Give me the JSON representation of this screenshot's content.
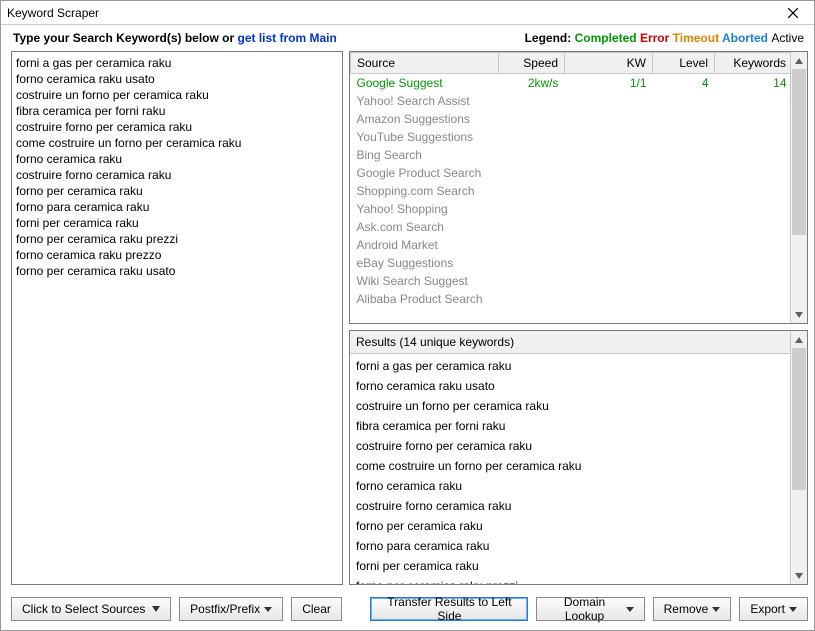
{
  "window": {
    "title": "Keyword Scraper"
  },
  "header": {
    "prompt_prefix": "Type your Search Keyword(s) below or ",
    "prompt_link": "get list from Main",
    "legend_label": "Legend:",
    "legend_completed": "Completed",
    "legend_error": "Error",
    "legend_timeout": "Timeout",
    "legend_aborted": "Aborted",
    "legend_active": "Active"
  },
  "keywords_text": "forni a gas per ceramica raku\nforno ceramica raku usato\ncostruire un forno per ceramica raku\nfibra ceramica per forni raku\ncostruire forno per ceramica raku\ncome costruire un forno per ceramica raku\nforno ceramica raku\ncostruire forno ceramica raku\nforno per ceramica raku\nforno para ceramica raku\nforni per ceramica raku\nforno per ceramica raku prezzi\nforno ceramica raku prezzo\nforno per ceramica raku usato",
  "table": {
    "columns": {
      "source": "Source",
      "speed": "Speed",
      "kw": "KW",
      "level": "Level",
      "keywords": "Keywords"
    },
    "rows": [
      {
        "source": "Google Suggest",
        "speed": "2kw/s",
        "kw": "1/1",
        "level": "4",
        "keywords": "14",
        "status": "completed"
      },
      {
        "source": "Yahoo! Search Assist",
        "status": "idle"
      },
      {
        "source": "Amazon Suggestions",
        "status": "idle"
      },
      {
        "source": "YouTube Suggestions",
        "status": "idle"
      },
      {
        "source": "Bing Search",
        "status": "idle"
      },
      {
        "source": "Google Product Search",
        "status": "idle"
      },
      {
        "source": "Shopping.com Search",
        "status": "idle"
      },
      {
        "source": "Yahoo! Shopping",
        "status": "idle"
      },
      {
        "source": "Ask.com Search",
        "status": "idle"
      },
      {
        "source": "Android Market",
        "status": "idle"
      },
      {
        "source": "eBay Suggestions",
        "status": "idle"
      },
      {
        "source": "Wiki Search Suggest",
        "status": "idle"
      },
      {
        "source": "Alibaba Product Search",
        "status": "idle"
      }
    ]
  },
  "results": {
    "header": "Results (14 unique keywords)",
    "items": [
      "forni a gas per ceramica raku",
      "forno ceramica raku usato",
      "costruire un forno per ceramica raku",
      "fibra ceramica per forni raku",
      "costruire forno per ceramica raku",
      "come costruire un forno per ceramica raku",
      "forno ceramica raku",
      "costruire forno ceramica raku",
      "forno per ceramica raku",
      "forno para ceramica raku",
      "forni per ceramica raku",
      "forno per ceramica raku prezzi"
    ]
  },
  "buttons": {
    "select_sources": "Click to Select Sources",
    "postfix": "Postfix/Prefix",
    "clear": "Clear",
    "transfer": "Transfer Results to Left Side",
    "domain_lookup": "Domain Lookup",
    "remove": "Remove",
    "export": "Export"
  }
}
